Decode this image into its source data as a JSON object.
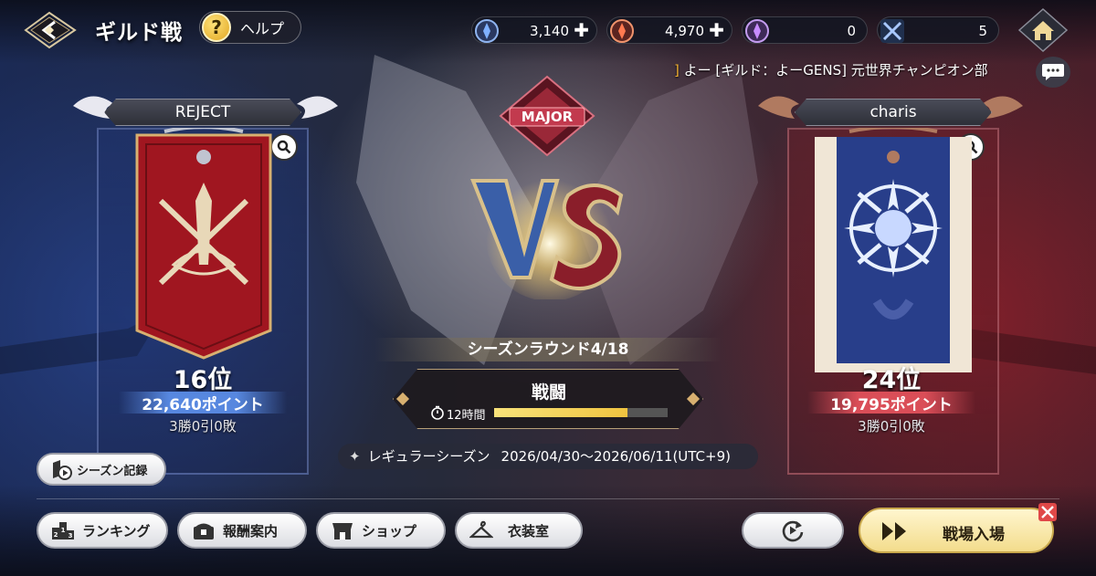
{
  "header": {
    "title": "ギルド戦",
    "help_label": "ヘルプ"
  },
  "currencies": [
    {
      "name": "blue-gem",
      "value": "3,140",
      "color": "#5b8de0"
    },
    {
      "name": "red-gem",
      "value": "4,970",
      "color": "#e0583c"
    },
    {
      "name": "purple-gem",
      "value": "0",
      "color": "#b87be6"
    },
    {
      "name": "swords",
      "value": "5",
      "color": "#7aa8e8"
    }
  ],
  "ticker": {
    "mark": "]",
    "text": " よー [ギルド：よーGENS] 元世界チャンピオン部"
  },
  "badge": {
    "text": "MAJOR"
  },
  "left_guild": {
    "name": "REJECT",
    "rank": "16位",
    "points": "22,640ポイント",
    "record": "3勝0引0敗",
    "banner_color": "#a01620"
  },
  "right_guild": {
    "name": "charis",
    "rank": "24位",
    "points": "19,795ポイント",
    "record": "3勝0引0敗",
    "banner_color": "#283e8a"
  },
  "center": {
    "season_round": "シーズンラウンド4/18",
    "battle_label": "戦闘",
    "timer": "12時間",
    "progress": 0.77,
    "season_type": "レギュラーシーズン",
    "season_dates": "2026/04/30～2026/06/11(UTC+9)"
  },
  "buttons": {
    "season_record": "シーズン記録",
    "ranking": "ランキング",
    "rewards": "報酬案内",
    "shop": "ショップ",
    "wardrobe": "衣装室",
    "enter": "戦場入場"
  }
}
